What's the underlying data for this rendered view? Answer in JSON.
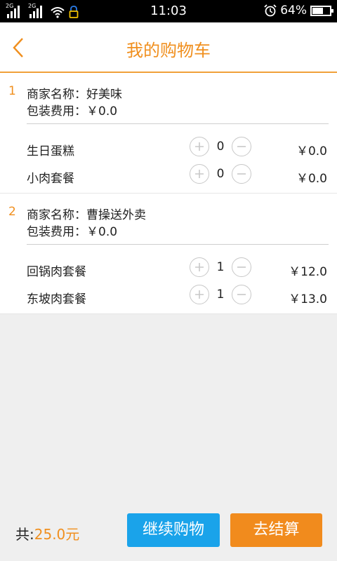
{
  "status_bar": {
    "network_1": "2G",
    "network_2": "2G",
    "time": "11:03",
    "battery_text": "64%",
    "battery_level": 0.64
  },
  "header": {
    "title": "我的购物车"
  },
  "shops": [
    {
      "index": "1",
      "merchant_line": "商家名称：好美味",
      "packaging_line": "包装费用：￥0.0",
      "items": [
        {
          "name": "生日蛋糕",
          "qty": "0",
          "price": "￥0.0"
        },
        {
          "name": "小肉套餐",
          "qty": "0",
          "price": "￥0.0"
        }
      ]
    },
    {
      "index": "2",
      "merchant_line": "商家名称：曹操送外卖",
      "packaging_line": "包装费用：￥0.0",
      "items": [
        {
          "name": "回锅肉套餐",
          "qty": "1",
          "price": "￥12.0"
        },
        {
          "name": "东坡肉套餐",
          "qty": "1",
          "price": "￥13.0"
        }
      ]
    }
  ],
  "footer": {
    "total_prefix": "共:",
    "total_value": "25.0元",
    "continue_label": "继续购物",
    "checkout_label": "去结算"
  },
  "colors": {
    "accent_orange": "#f08f1e",
    "continue_blue": "#1aa3ea",
    "checkout_orange": "#f18b1d"
  }
}
